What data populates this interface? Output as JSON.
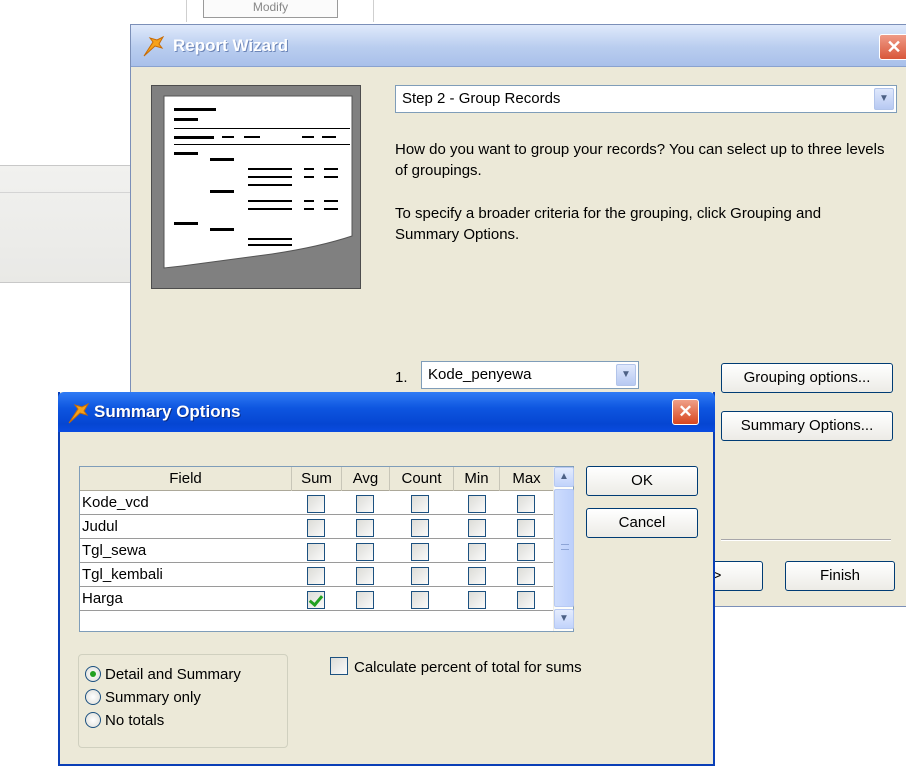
{
  "background": {
    "modify_label": "Modify"
  },
  "wizard": {
    "title": "Report Wizard",
    "close_symbol": "✕",
    "step_selected": "Step 2 - Group Records",
    "question": "How do you want to group your records? You can select up to three levels of groupings.",
    "hint": "To specify a broader criteria for the grouping, click Grouping and Summary Options.",
    "group_level_number": "1.",
    "group_field": "Kode_penyewa",
    "grouping_options_label": "Grouping options...",
    "summary_options_label": "Summary Options...",
    "next_label": ">",
    "finish_label": "Finish",
    "icons": {
      "title": "wizard-icon",
      "close": "close-icon",
      "dropdown": "chevron-down-icon"
    }
  },
  "summary": {
    "title": "Summary Options",
    "close_symbol": "✕",
    "columns": [
      "Field",
      "Sum",
      "Avg",
      "Count",
      "Min",
      "Max"
    ],
    "rows": [
      {
        "field": "Kode_vcd",
        "sum": false,
        "avg": false,
        "count": false,
        "min": false,
        "max": false
      },
      {
        "field": "Judul",
        "sum": false,
        "avg": false,
        "count": false,
        "min": false,
        "max": false
      },
      {
        "field": "Tgl_sewa",
        "sum": false,
        "avg": false,
        "count": false,
        "min": false,
        "max": false
      },
      {
        "field": "Tgl_kembali",
        "sum": false,
        "avg": false,
        "count": false,
        "min": false,
        "max": false
      },
      {
        "field": "Harga",
        "sum": true,
        "avg": false,
        "count": false,
        "min": false,
        "max": false
      }
    ],
    "ok_label": "OK",
    "cancel_label": "Cancel",
    "radio_options": [
      {
        "label": "Detail and Summary",
        "selected": true
      },
      {
        "label": "Summary only",
        "selected": false
      },
      {
        "label": "No totals",
        "selected": false
      }
    ],
    "percent_label": "Calculate percent of total for sums",
    "percent_checked": false
  },
  "colors": {
    "xp_blue_titlebar": "#0546d2",
    "dialog_face": "#ece9d8",
    "check_green": "#21a121",
    "close_red": "#d8461f"
  }
}
